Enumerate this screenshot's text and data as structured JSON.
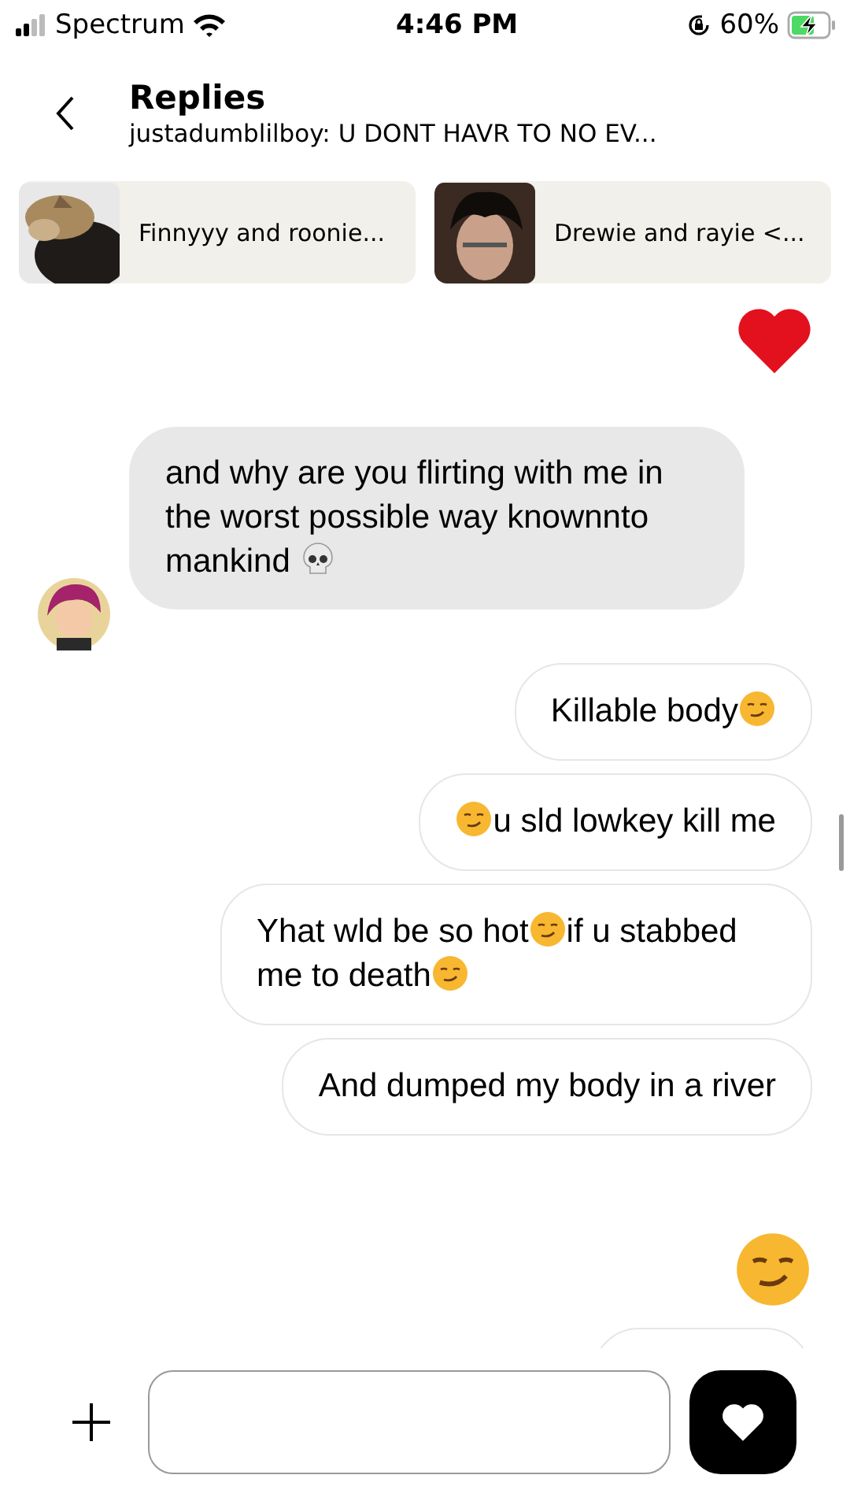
{
  "status_bar": {
    "carrier": "Spectrum",
    "time": "4:46 PM",
    "battery": "60%",
    "charging": true
  },
  "header": {
    "title": "Replies",
    "subtitle": "justadumblilboy: U DONT HAVR TO NO EV..."
  },
  "stories": [
    {
      "label": "Finnyyy and roonie...",
      "kind": "picture"
    },
    {
      "label": "Drewie and rayie <...",
      "kind": "picture"
    }
  ],
  "messages": [
    {
      "kind": "heart",
      "outgoing": true
    },
    {
      "kind": "bubble",
      "outgoing": false,
      "parts": [
        {
          "kind": "text",
          "text": "and why are you flirting with me in the worst possible way knownnto mankind "
        },
        {
          "kind": "skull"
        }
      ]
    },
    {
      "kind": "bubble",
      "outgoing": true,
      "parts": [
        {
          "kind": "text",
          "text": "Killable body"
        },
        {
          "kind": "smirk"
        }
      ]
    },
    {
      "kind": "bubble",
      "outgoing": true,
      "parts": [
        {
          "kind": "smirk"
        },
        {
          "kind": "text",
          "text": "u sld lowkey kill me"
        }
      ]
    },
    {
      "kind": "bubble",
      "outgoing": true,
      "parts": [
        {
          "kind": "text",
          "text": "Yhat wld be so hot"
        },
        {
          "kind": "smirk"
        },
        {
          "kind": "text",
          "text": "if u stabbed me to death"
        },
        {
          "kind": "smirk"
        }
      ]
    },
    {
      "kind": "bubble",
      "outgoing": true,
      "parts": [
        {
          "kind": "text",
          "text": "And dumped my body in a river"
        }
      ]
    },
    {
      "kind": "smirk",
      "outgoing": true
    },
    {
      "kind": "partial",
      "outgoing": true
    }
  ]
}
